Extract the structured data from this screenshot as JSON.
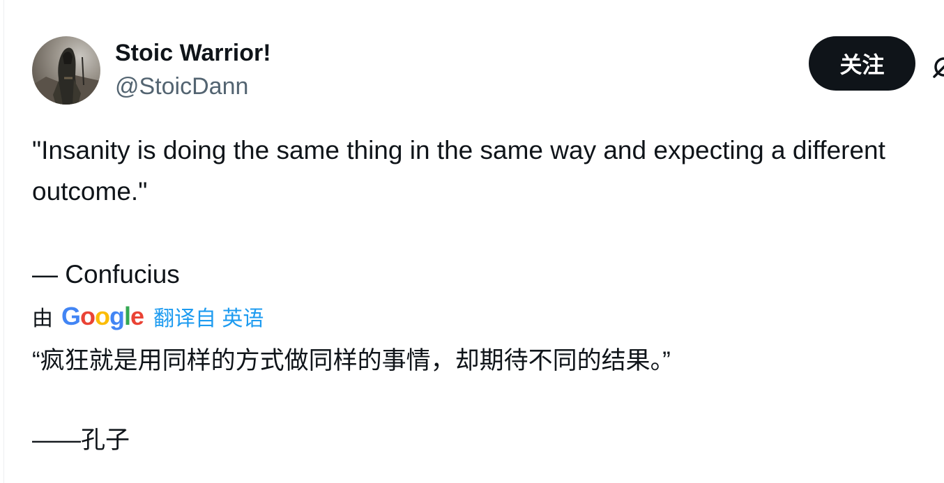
{
  "author": {
    "display_name": "Stoic Warrior!",
    "handle": "@StoicDann"
  },
  "actions": {
    "follow_label": "关注"
  },
  "tweet": {
    "text": "\"Insanity is doing the same thing in the same way and expecting a different outcome.\"",
    "attribution": "— Confucius"
  },
  "translation": {
    "by_label": "由",
    "provider": "Google",
    "translated_from": "翻译自 英语",
    "quote": "“疯狂就是用同样的方式做同样的事情，却期待不同的结果。”",
    "attribution": "——孔子"
  },
  "icons": {
    "avatar": "hooded-warrior-avatar",
    "grok": "grok-icon"
  },
  "colors": {
    "text": "#0f1419",
    "secondary": "#536471",
    "link": "#1d9bf0",
    "button_bg": "#0f1419",
    "button_text": "#ffffff"
  }
}
